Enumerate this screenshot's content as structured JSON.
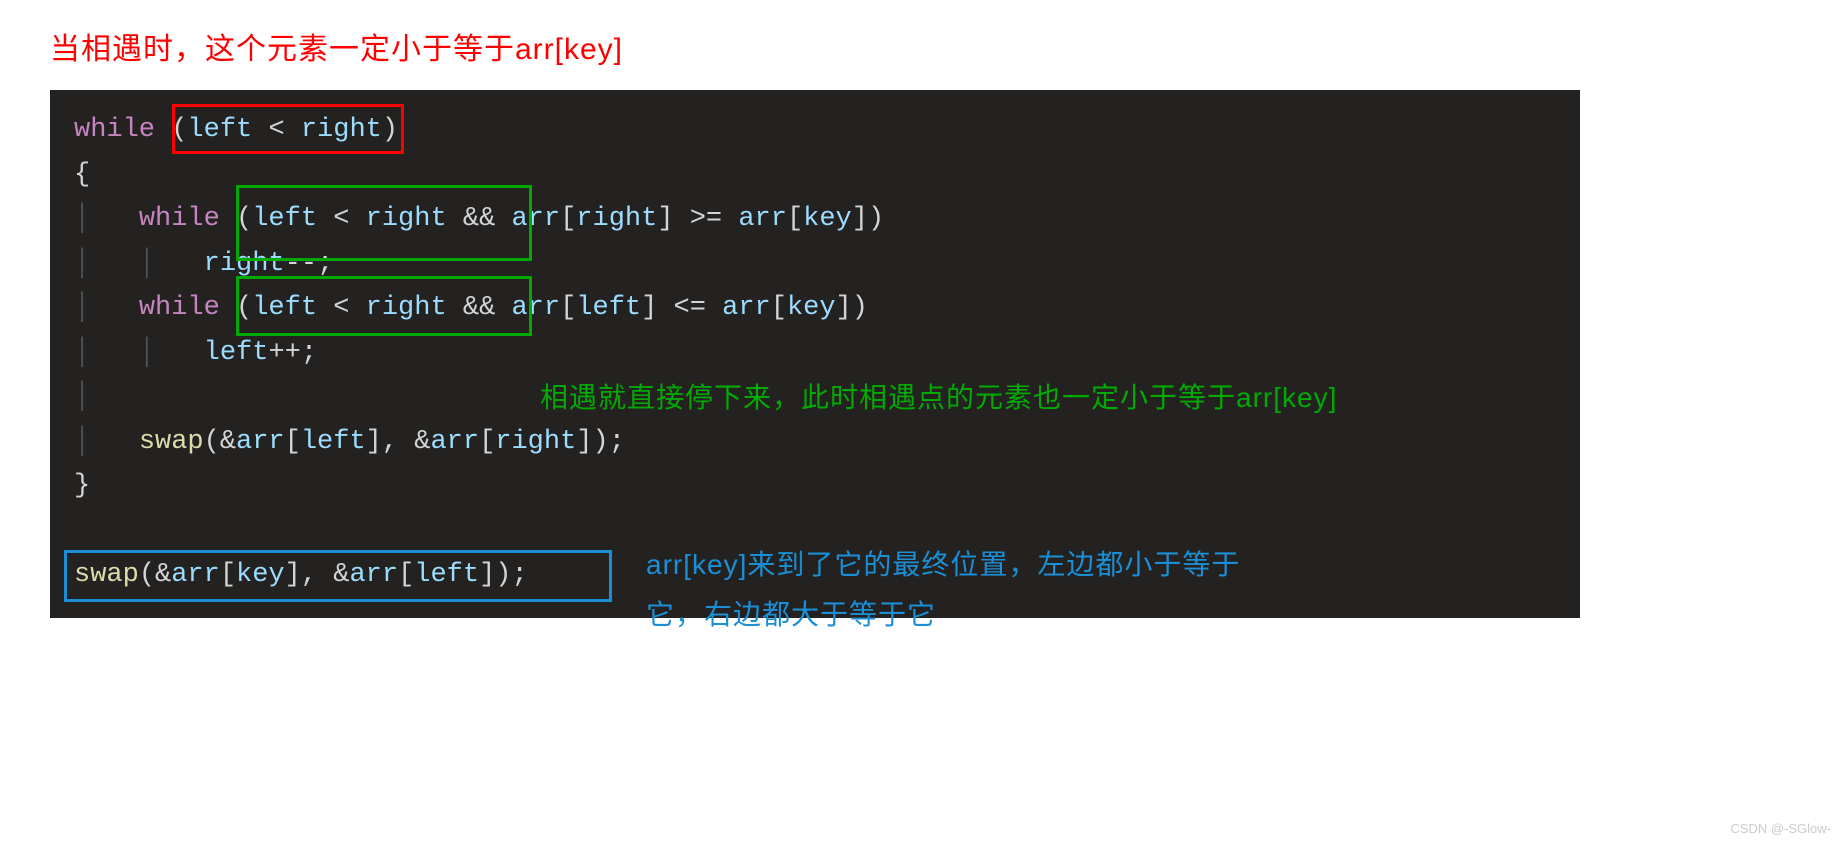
{
  "title_annotation": "当相遇时，这个元素一定小于等于arr[key]",
  "code": {
    "l1": {
      "while": "while",
      "left": "left",
      "lt": "<",
      "right": "right"
    },
    "l2": {
      "brace": "{"
    },
    "l3": {
      "while": "while",
      "left": "left",
      "lt": "<",
      "right": "right",
      "and": "&&",
      "arr1": "arr",
      "idx1": "right",
      "ge": ">=",
      "arr2": "arr",
      "idx2": "key"
    },
    "l4": {
      "right": "right",
      "dec": "--",
      "semi": ";"
    },
    "l5": {
      "while": "while",
      "left": "left",
      "lt": "<",
      "right": "right",
      "and": "&&",
      "arr1": "arr",
      "idx1": "left",
      "le": "<=",
      "arr2": "arr",
      "idx2": "key"
    },
    "l6": {
      "left": "left",
      "inc": "++",
      "semi": ";"
    },
    "l7": {
      "swap": "swap",
      "arr1": "arr",
      "idx1": "left",
      "arr2": "arr",
      "idx2": "right"
    },
    "l8": {
      "brace": "}"
    },
    "l9": {
      "swap": "swap",
      "arr1": "arr",
      "idx1": "key",
      "arr2": "arr",
      "idx2": "left"
    }
  },
  "green_annotation": "相遇就直接停下来，此时相遇点的元素也一定小于等于arr[key]",
  "blue_annotation_1": "arr[key]来到了它的最终位置，左边都小于等于",
  "blue_annotation_2": "它，右边都大于等于它",
  "watermark": "CSDN @-SGlow-"
}
